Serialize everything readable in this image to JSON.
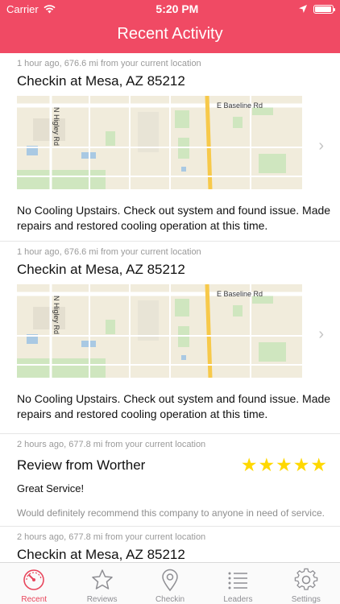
{
  "status": {
    "carrier": "Carrier",
    "time": "5:20 PM"
  },
  "nav": {
    "title": "Recent Activity"
  },
  "colors": {
    "accent": "#f04a64",
    "tab_active": "#e8465c",
    "star": "#ffd800"
  },
  "feed": [
    {
      "meta": "1 hour ago, 676.6 mi from your current location",
      "title": "Checkin at Mesa, AZ 85212",
      "map": {
        "road_east": "E Baseline Rd",
        "road_north": "N Higley Rd"
      },
      "desc": "No Cooling Upstairs. Check out system and found issue. Made repairs and restored cooling operation at this time."
    },
    {
      "meta": "1 hour ago, 676.6 mi from your current location",
      "title": "Checkin at Mesa, AZ 85212",
      "map": {
        "road_east": "E Baseline Rd",
        "road_north": "N Higley Rd"
      },
      "desc": "No Cooling Upstairs. Check out system and found issue. Made repairs and restored cooling operation at this time."
    },
    {
      "meta": "2 hours ago, 677.8 mi from your current location",
      "title": "Review from Worther",
      "rating": 5,
      "subtitle": "Great Service!",
      "body": "Would definitely recommend this company to anyone in need of service."
    },
    {
      "meta": "2 hours ago, 677.8 mi from your current location",
      "title": "Checkin at Mesa, AZ 85212"
    }
  ],
  "tabs": [
    {
      "label": "Recent",
      "icon": "gauge-icon",
      "active": true
    },
    {
      "label": "Reviews",
      "icon": "star-icon",
      "active": false
    },
    {
      "label": "Checkin",
      "icon": "location-pin-icon",
      "active": false
    },
    {
      "label": "Leaders",
      "icon": "list-icon",
      "active": false
    },
    {
      "label": "Settings",
      "icon": "gear-icon",
      "active": false
    }
  ]
}
